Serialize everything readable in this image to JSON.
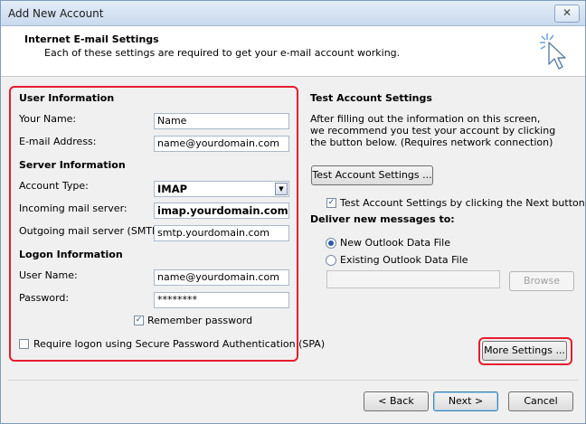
{
  "window": {
    "title": "Add New Account",
    "close_glyph": "✕"
  },
  "header": {
    "title": "Internet E-mail Settings",
    "subtitle": "Each of these settings are required to get your e-mail account working.",
    "icon": "cursor-sparkle-icon"
  },
  "left": {
    "user_info": {
      "heading": "User Information",
      "your_name_label": "Your Name:",
      "your_name_value": "Name",
      "email_label": "E-mail Address:",
      "email_value": "name@yourdomain.com"
    },
    "server_info": {
      "heading": "Server Information",
      "account_type_label": "Account Type:",
      "account_type_value": "IMAP",
      "incoming_label": "Incoming mail server:",
      "incoming_value": "imap.yourdomain.com",
      "outgoing_label": "Outgoing mail server (SMTP):",
      "outgoing_value": "smtp.yourdomain.com"
    },
    "logon_info": {
      "heading": "Logon Information",
      "username_label": "User Name:",
      "username_value": "name@yourdomain.com",
      "password_label": "Password:",
      "password_value": "********",
      "remember_label": "Remember password",
      "remember_checked": true,
      "spa_label": "Require logon using Secure Password Authentication (SPA)",
      "spa_checked": false
    }
  },
  "right": {
    "heading": "Test Account Settings",
    "description": "After filling out the information on this screen, we recommend you test your account by clicking the button below. (Requires network connection)",
    "test_button": "Test Account Settings ...",
    "test_next_label": "Test Account Settings by clicking the Next button",
    "test_next_checked": true,
    "deliver_heading": "Deliver new messages to:",
    "new_data_file_label": "New Outlook Data File",
    "existing_data_file_label": "Existing Outlook Data File",
    "selected_option": "New Outlook Data File",
    "existing_path_value": "",
    "browse_button": "Browse",
    "more_settings_button": "More Settings ..."
  },
  "footer": {
    "back_button": "< Back",
    "next_button": "Next >",
    "cancel_button": "Cancel"
  },
  "colors": {
    "highlight": "#e81c2f",
    "title_bg": "#c9d9ee"
  }
}
